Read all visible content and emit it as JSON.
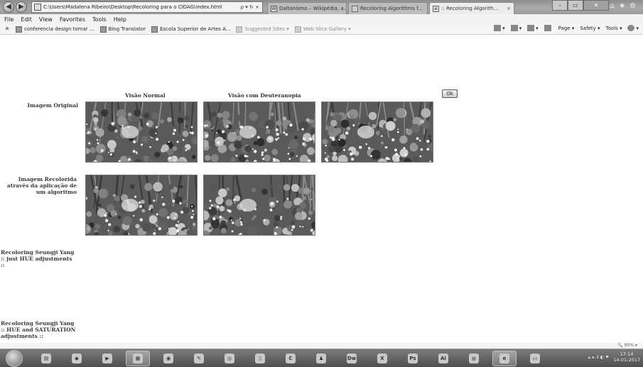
{
  "browser": {
    "address_url": "C:\\Users\\Madalena Ribeiro\\Desktop\\Recoloring para o CIDAG\\index.html",
    "address_controls": "ρ ▾ ↻ ×",
    "tabs": [
      {
        "label": "Daltonismo – Wikipédia, a...",
        "icon": "W"
      },
      {
        "label": "Recoloring Algorithms f...",
        "icon": "::"
      },
      {
        "label": ":: Recoloring Algorith...",
        "icon": "e"
      }
    ],
    "menu": [
      "File",
      "Edit",
      "View",
      "Favorites",
      "Tools",
      "Help"
    ],
    "favorites": [
      {
        "label": "conferencia design tomar ...",
        "dim": false
      },
      {
        "label": "Bing Translator",
        "dim": false
      },
      {
        "label": "Escola Superior de Artes A...",
        "dim": false
      },
      {
        "label": "Suggested Sites ▾",
        "dim": true
      },
      {
        "label": "Web Slice Gallery ▾",
        "dim": true
      }
    ],
    "command_bar": [
      "▾",
      "▾",
      "▾",
      "Page ▾",
      "Safety ▾",
      "Tools ▾",
      "▾"
    ],
    "zoom": "90%"
  },
  "page": {
    "col_headers": [
      "Visão Normal",
      "Visão com Deuteranopia"
    ],
    "ok_label": "Ok",
    "rows": [
      {
        "label": "Imagem Original"
      },
      {
        "label": "Imagem Recolorida através da aplicação de um algoritmo"
      },
      {
        "label": "Recoloring Seungji Yang :: just HUE adjustments ::"
      },
      {
        "label": "Recoloring Seungji Yang :: HUE and SATURATION adjustments ::"
      }
    ]
  },
  "taskbar": {
    "apps": [
      "folder",
      "dropbox",
      "media",
      "explorer",
      "chrome",
      "paint",
      "firefox",
      "doc",
      "C",
      "user",
      "Dw",
      "X",
      "Ps",
      "Ai",
      "globe",
      "ie",
      "app"
    ],
    "time": "17:14",
    "date": "14-01-2017"
  }
}
